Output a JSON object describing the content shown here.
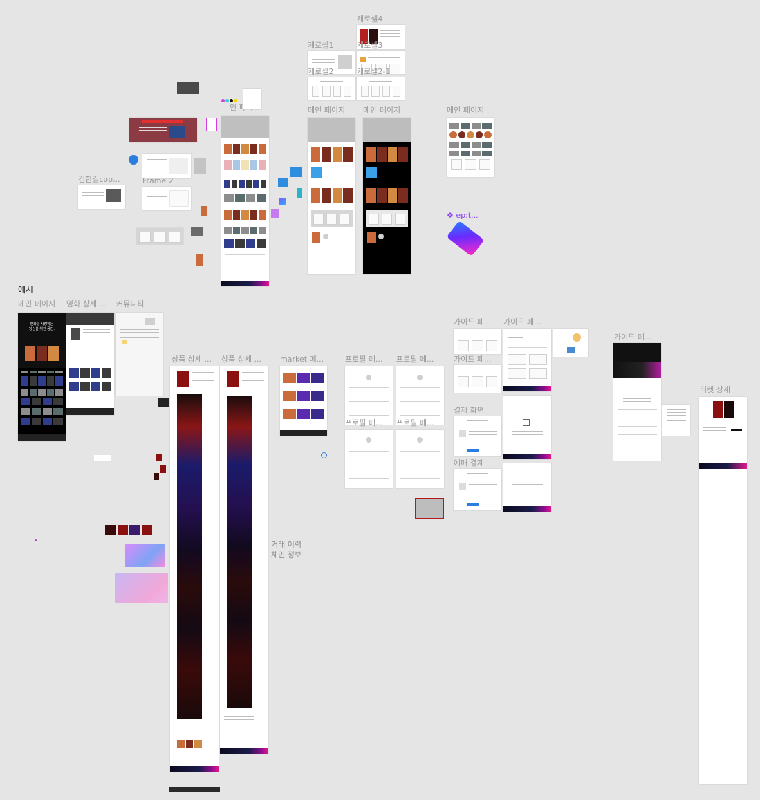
{
  "labels": {
    "carousel4": "캐로셀4",
    "carousel1": "캐로셀1",
    "carousel3": "캐로셀3",
    "carousel2": "캐로셀2",
    "carousel2_1": "캐로셀2-1",
    "main_a": "메인 페이지",
    "main_b": "메인 페이지",
    "main_c": "메인 페이지",
    "main_mini": "인 페이",
    "kimhangil": "김한길cop...",
    "frame2": "Frame 2",
    "ep_component": "❖ ep:t...",
    "example": "예시",
    "ex_main": "메인 페이지",
    "ex_movie": "영화 상세 ...",
    "ex_community": "커뮤니티",
    "product_a": "상품 상세 ...",
    "product_b": "상품 상세 ...",
    "market": "market 페...",
    "profile_a": "프로필 페...",
    "profile_b": "프로필 페...",
    "profile_c": "프로필 페...",
    "profile_d": "프로필 페...",
    "guide_a": "가이드 페...",
    "guide_b": "가이드 페...",
    "guide_c": "가이드 페...",
    "guide_d": "가이드 페...",
    "payment": "결제 화면",
    "reservation": "예매 결제",
    "ticket_detail": "티켓 상세",
    "trade_history": "거래 이력",
    "chain_info": "체인 정보"
  },
  "example_hero": {
    "line1": "영화를 사랑하는",
    "line2": "당신을 위한 공간."
  },
  "colors": {
    "canvas": "#e5e5e5",
    "accent_purple": "#8b3dff",
    "footer_pink": "#e0188c",
    "footer_navy": "#0b0b20"
  }
}
